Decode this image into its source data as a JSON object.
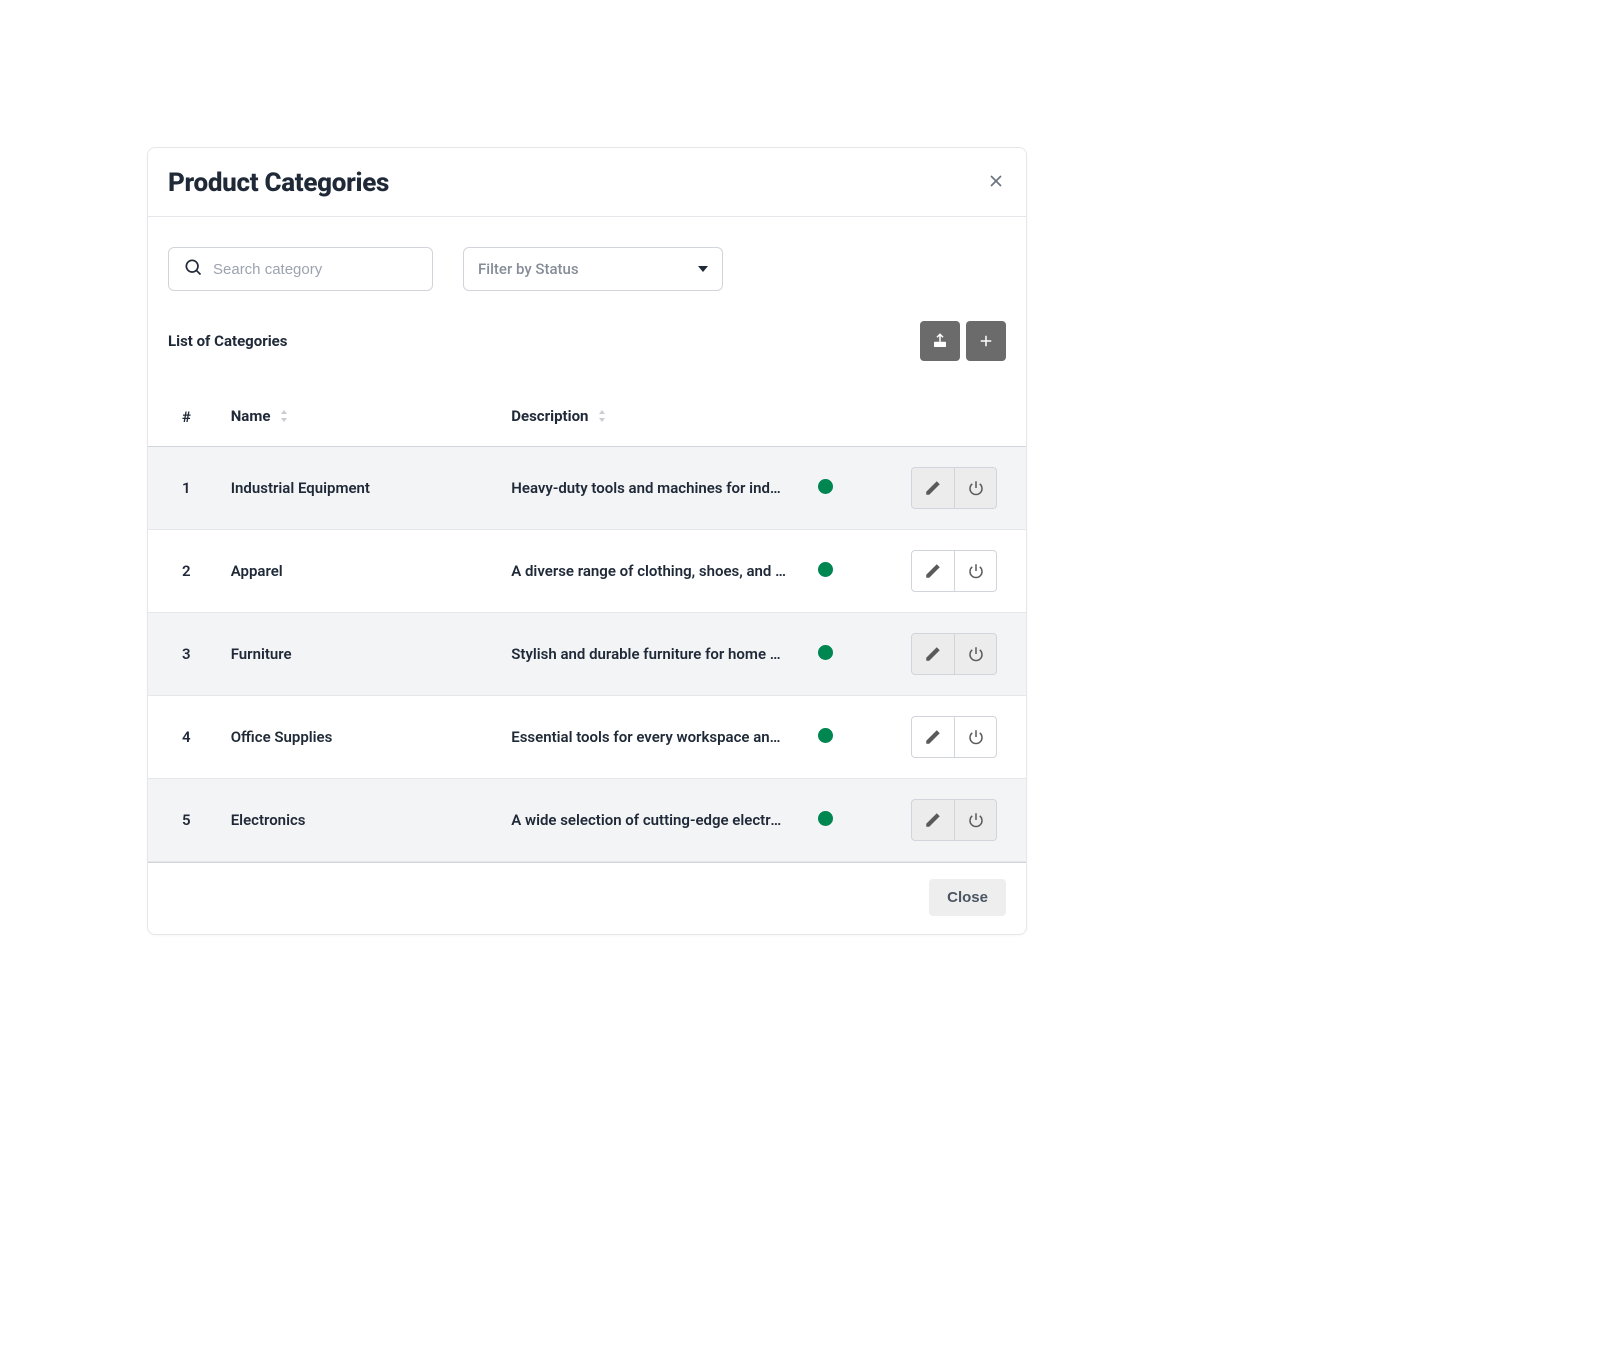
{
  "modal": {
    "title": "Product Categories"
  },
  "search": {
    "placeholder": "Search category"
  },
  "filter": {
    "placeholder": "Filter by Status"
  },
  "list": {
    "title": "List of Categories"
  },
  "table": {
    "columns": {
      "index": "#",
      "name": "Name",
      "description": "Description"
    },
    "rows": [
      {
        "idx": "1",
        "name": "Industrial Equipment",
        "description": "Heavy-duty tools and machines for industrial use",
        "status": "active"
      },
      {
        "idx": "2",
        "name": "Apparel",
        "description": "A diverse range of clothing, shoes, and accessories",
        "status": "active"
      },
      {
        "idx": "3",
        "name": "Furniture",
        "description": "Stylish and durable furniture for home and office",
        "status": "active"
      },
      {
        "idx": "4",
        "name": "Office Supplies",
        "description": "Essential tools for every workspace and task",
        "status": "active"
      },
      {
        "idx": "5",
        "name": "Electronics",
        "description": "A wide selection of cutting-edge electronics",
        "status": "active"
      }
    ]
  },
  "footer": {
    "close": "Close"
  },
  "colors": {
    "status_active": "#008650"
  }
}
